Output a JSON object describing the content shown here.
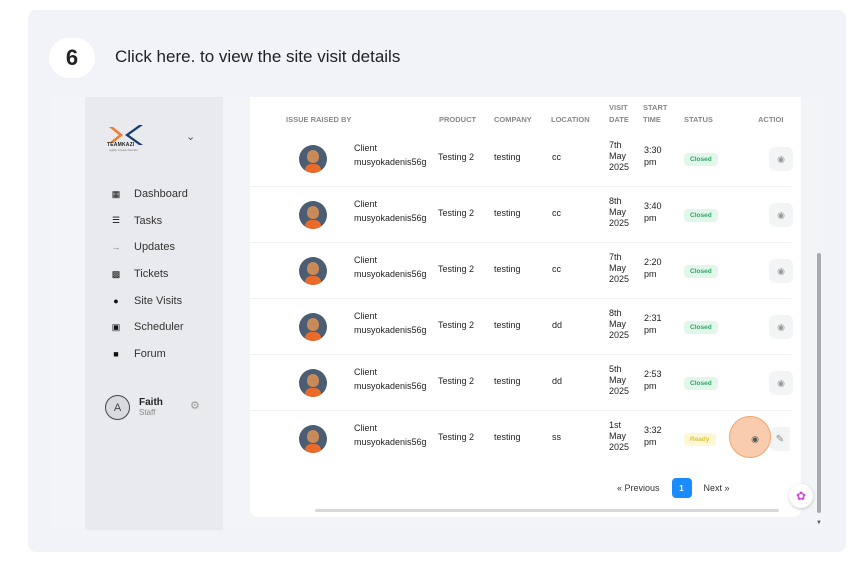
{
  "step": {
    "number": "6",
    "instruction": "Click here. to view the site visit details"
  },
  "sidebar": {
    "logo_text": "TEAMKAZI",
    "logo_subtext": "Agility Create Results",
    "items": [
      {
        "label": "Dashboard",
        "icon": "dashboard-icon"
      },
      {
        "label": "Tasks",
        "icon": "tasks-icon"
      },
      {
        "label": "Updates",
        "icon": "updates-icon"
      },
      {
        "label": "Tickets",
        "icon": "ticket-icon"
      },
      {
        "label": "Site Visits",
        "icon": "location-pin-icon"
      },
      {
        "label": "Scheduler",
        "icon": "calendar-icon"
      },
      {
        "label": "Forum",
        "icon": "chat-icon"
      }
    ],
    "user": {
      "initial": "A",
      "name": "Faith",
      "role": "Staff"
    }
  },
  "table": {
    "headers": {
      "issue_raised_by": "ISSUE RAISED BY",
      "product": "PRODUCT",
      "company": "COMPANY",
      "location": "LOCATION",
      "visit_date_1": "VISIT",
      "visit_date_2": "DATE",
      "start_time_1": "START",
      "start_time_2": "TIME",
      "status": "STATUS",
      "action": "ACTIOI"
    },
    "rows": [
      {
        "client_line1": "Client",
        "client_line2": "musyokadenis56g",
        "product": "Testing 2",
        "company": "testing",
        "location": "cc",
        "date1": "7th",
        "date2": "May",
        "date3": "2025",
        "time1": "3:30",
        "time2": "pm",
        "status": "Closed"
      },
      {
        "client_line1": "Client",
        "client_line2": "musyokadenis56g",
        "product": "Testing 2",
        "company": "testing",
        "location": "cc",
        "date1": "8th",
        "date2": "May",
        "date3": "2025",
        "time1": "3:40",
        "time2": "pm",
        "status": "Closed"
      },
      {
        "client_line1": "Client",
        "client_line2": "musyokadenis56g",
        "product": "Testing 2",
        "company": "testing",
        "location": "cc",
        "date1": "7th",
        "date2": "May",
        "date3": "2025",
        "time1": "2:20",
        "time2": "pm",
        "status": "Closed"
      },
      {
        "client_line1": "Client",
        "client_line2": "musyokadenis56g",
        "product": "Testing 2",
        "company": "testing",
        "location": "dd",
        "date1": "8th",
        "date2": "May",
        "date3": "2025",
        "time1": "2:31",
        "time2": "pm",
        "status": "Closed"
      },
      {
        "client_line1": "Client",
        "client_line2": "musyokadenis56g",
        "product": "Testing 2",
        "company": "testing",
        "location": "dd",
        "date1": "5th",
        "date2": "May",
        "date3": "2025",
        "time1": "2:53",
        "time2": "pm",
        "status": "Closed"
      },
      {
        "client_line1": "Client",
        "client_line2": "musyokadenis56g",
        "product": "Testing 2",
        "company": "testing",
        "location": "ss",
        "date1": "1st",
        "date2": "May",
        "date3": "2025",
        "time1": "3:32",
        "time2": "pm",
        "status": "Ready"
      }
    ]
  },
  "pagination": {
    "previous": "« Previous",
    "current": "1",
    "next": "Next »"
  },
  "colors": {
    "accent": "#1a8cff",
    "closed": "#2fa866",
    "ready": "#e4c230",
    "highlight": "#f3a36a"
  }
}
